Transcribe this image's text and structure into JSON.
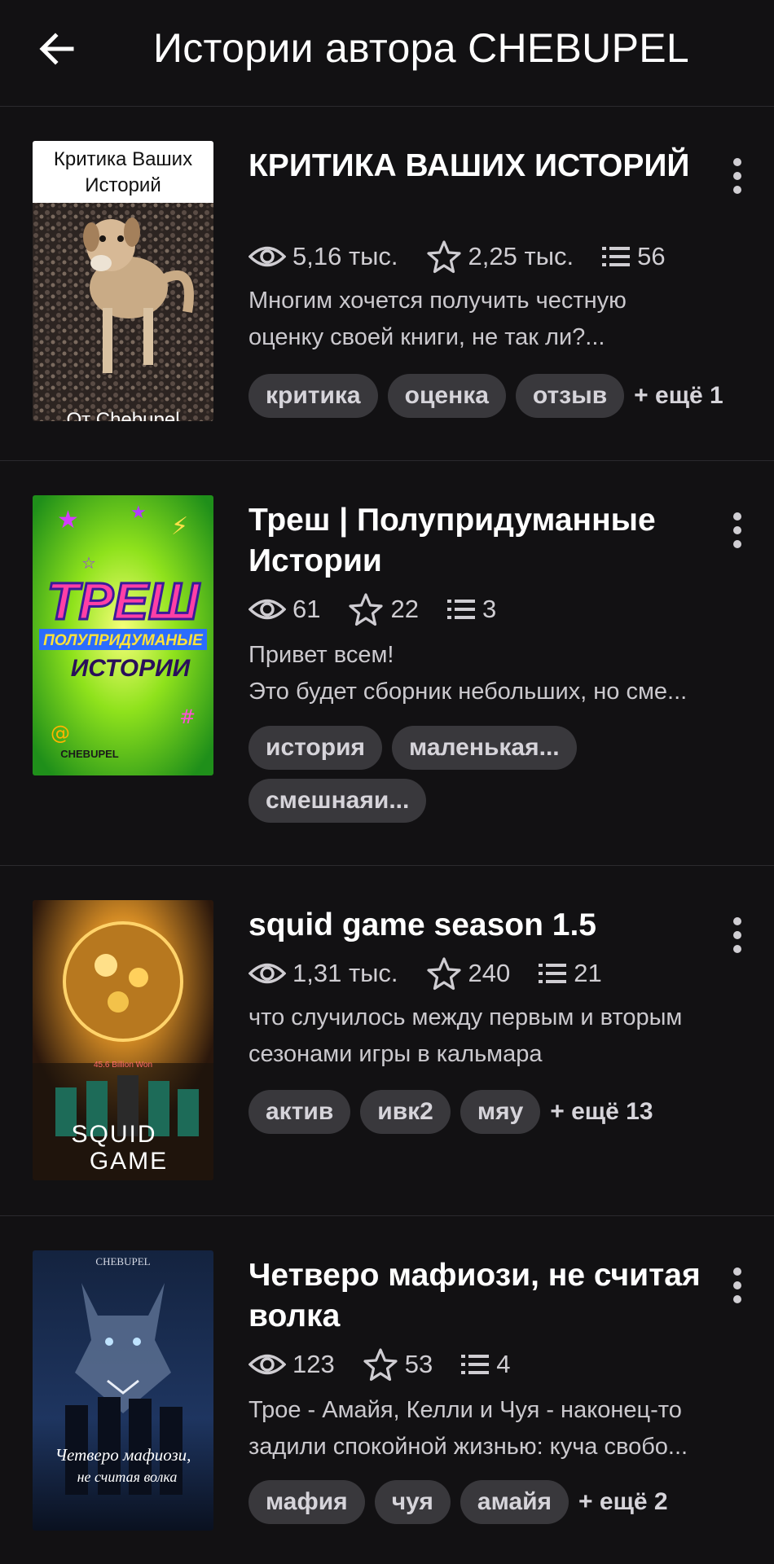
{
  "header": {
    "title": "Истории автора CHEBUPEL"
  },
  "stories": [
    {
      "title": "КРИТИКА ВАШИХ ИСТОРИЙ",
      "cover": {
        "caption_top": "Критика Ваших Историй",
        "caption_bottom": "От Chebupel"
      },
      "views": "5,16 тыс.",
      "stars": "2,25 тыс.",
      "chapters": "56",
      "desc_lines": [
        "Многим хочется получить честную",
        "оценку своей книги, не так ли?..."
      ],
      "tags": [
        "критика",
        "оценка",
        "отзыв"
      ],
      "more_tags": "+ ещё 1"
    },
    {
      "title": "Треш | Полупридуманные Истории",
      "cover": {
        "title_big": "ТРЕШ",
        "title_mid": "ПОЛУПРИДУМАНЫЕ",
        "title_low": "ИСТОРИИ",
        "author": "CHEBUPEL"
      },
      "views": "61",
      "stars": "22",
      "chapters": "3",
      "desc_lines": [
        "Привет всем!",
        "Это будет сборник небольших, но сме..."
      ],
      "tags": [
        "история",
        "маленькая...",
        "смешнаяи..."
      ],
      "more_tags": ""
    },
    {
      "title": "squid game season 1.5",
      "cover": {
        "prize": "45.6 Billion Won",
        "logo_top": "SQUID",
        "logo_bottom": "GAME"
      },
      "views": "1,31 тыс.",
      "stars": "240",
      "chapters": "21",
      "desc_lines": [
        "что случилось между первым и вторым",
        "сезонами игры в кальмара"
      ],
      "tags": [
        "актив",
        "ивк2",
        "мяу"
      ],
      "more_tags": "+ ещё 13"
    },
    {
      "title": "Четверо мафиози, не считая волка",
      "cover": {
        "author": "CHEBUPEL",
        "title_a": "Четверо мафиози,",
        "title_b": "не считая волка"
      },
      "views": "123",
      "stars": "53",
      "chapters": "4",
      "desc_lines": [
        "Трое - Амайя, Келли и Чуя - наконец-то",
        "задили спокойной жизнью: куча свобо..."
      ],
      "tags": [
        "мафия",
        "чуя",
        "амайя"
      ],
      "more_tags": "+ ещё 2"
    }
  ]
}
